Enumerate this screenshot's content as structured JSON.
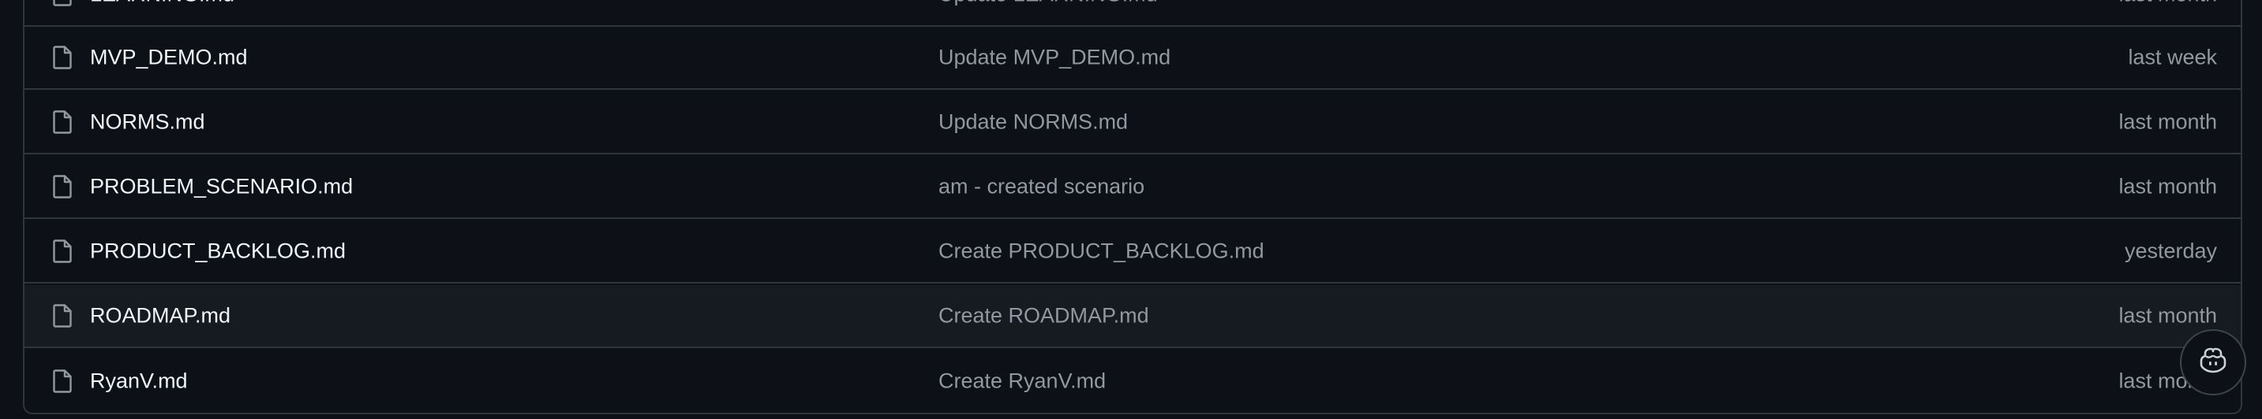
{
  "files": [
    {
      "name": "LEARNING.md",
      "message": "Update LEARNING.md",
      "time": "last month"
    },
    {
      "name": "MVP_DEMO.md",
      "message": "Update MVP_DEMO.md",
      "time": "last week"
    },
    {
      "name": "NORMS.md",
      "message": "Update NORMS.md",
      "time": "last month"
    },
    {
      "name": "PROBLEM_SCENARIO.md",
      "message": "am - created scenario",
      "time": "last month"
    },
    {
      "name": "PRODUCT_BACKLOG.md",
      "message": "Create PRODUCT_BACKLOG.md",
      "time": "yesterday"
    },
    {
      "name": "ROADMAP.md",
      "message": "Create ROADMAP.md",
      "time": "last month"
    },
    {
      "name": "RyanV.md",
      "message": "Create RyanV.md",
      "time": "last month"
    }
  ],
  "icons": {
    "file": "file-icon",
    "copilot": "copilot-icon"
  },
  "colors": {
    "background": "#0d1117",
    "border": "#30363d",
    "text_primary": "#f0f6fc",
    "text_muted": "#9198a1",
    "row_hover": "#161b22"
  }
}
